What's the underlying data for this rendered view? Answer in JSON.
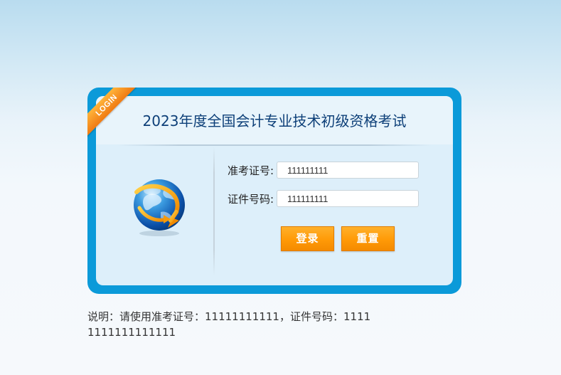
{
  "ribbon": {
    "text": "LOGIN"
  },
  "header": {
    "title": "2023年度全国会计专业技术初级资格考试"
  },
  "form": {
    "ticket_label": "准考证号:",
    "ticket_value": "111111111",
    "id_label": "证件号码:",
    "id_value": "111111111"
  },
  "buttons": {
    "login_label": "登录",
    "reset_label": "重置"
  },
  "note": {
    "text": "说明：请使用准考证号：11111111111，证件号码：11111111111111111"
  },
  "icons": {
    "globe": "globe-arrow-icon"
  },
  "colors": {
    "frame": "#0b9ad9",
    "title": "#0d3f78",
    "button": "#ff9a07",
    "ribbon": "#f58a16"
  }
}
